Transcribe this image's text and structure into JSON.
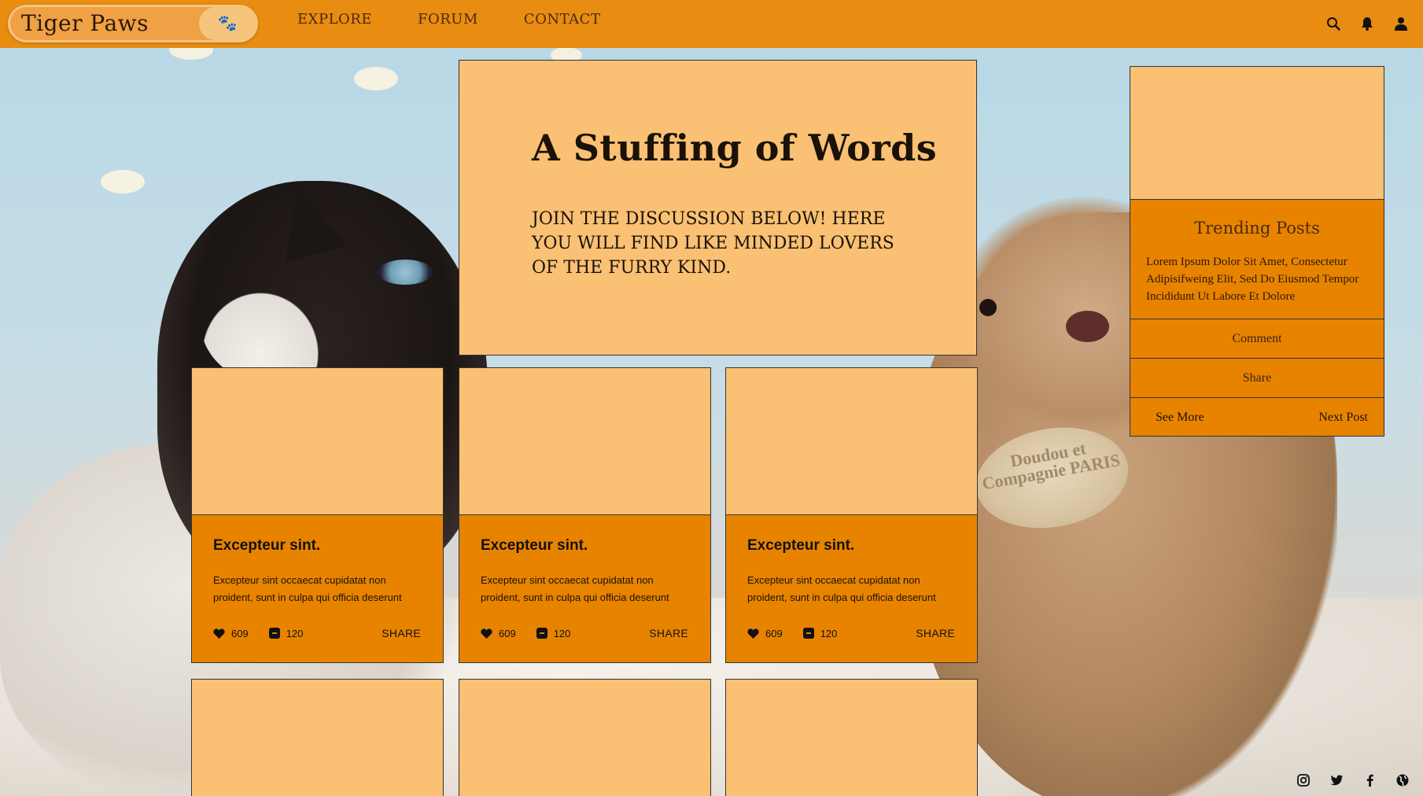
{
  "brand": {
    "name": "Tiger Paws",
    "paw_glyph": "🐾"
  },
  "nav": {
    "links": [
      "EXPLORE",
      "FORUM",
      "CONTACT"
    ],
    "icons": [
      "search-icon",
      "bell-icon",
      "user-icon"
    ]
  },
  "hero": {
    "title": "A Stuffing of Words",
    "subtitle": "Join the discussion below! Here you will find like minded lovers of the furry kind."
  },
  "cards": [
    {
      "title": "Excepteur sint.",
      "text": "Excepteur sint occaecat cupidatat non proident, sunt in culpa qui officia deserunt",
      "likes": "609",
      "comments": "120",
      "share": "SHARE"
    },
    {
      "title": "Excepteur sint.",
      "text": "Excepteur sint occaecat cupidatat non proident, sunt in culpa qui officia deserunt",
      "likes": "609",
      "comments": "120",
      "share": "SHARE"
    },
    {
      "title": "Excepteur sint.",
      "text": "Excepteur sint occaecat cupidatat non proident, sunt in culpa qui officia deserunt",
      "likes": "609",
      "comments": "120",
      "share": "SHARE"
    }
  ],
  "sidebar": {
    "title": "Trending Posts",
    "text": "Lorem Ipsum Dolor Sit Amet, Consectetur Adipisifweing Elit, Sed Do Eiusmod Tempor Incididunt Ut Labore Et Dolore",
    "comment": "Comment",
    "share": "Share",
    "see_more": "See More",
    "next_post": "Next Post"
  },
  "background": {
    "tag_text": "Doudou et Compagnie PARIS"
  },
  "social": [
    "instagram-icon",
    "twitter-icon",
    "facebook-icon",
    "globe-icon"
  ],
  "colors": {
    "nav": "#e88c12",
    "card": "#e88300",
    "panel": "#fac073"
  }
}
